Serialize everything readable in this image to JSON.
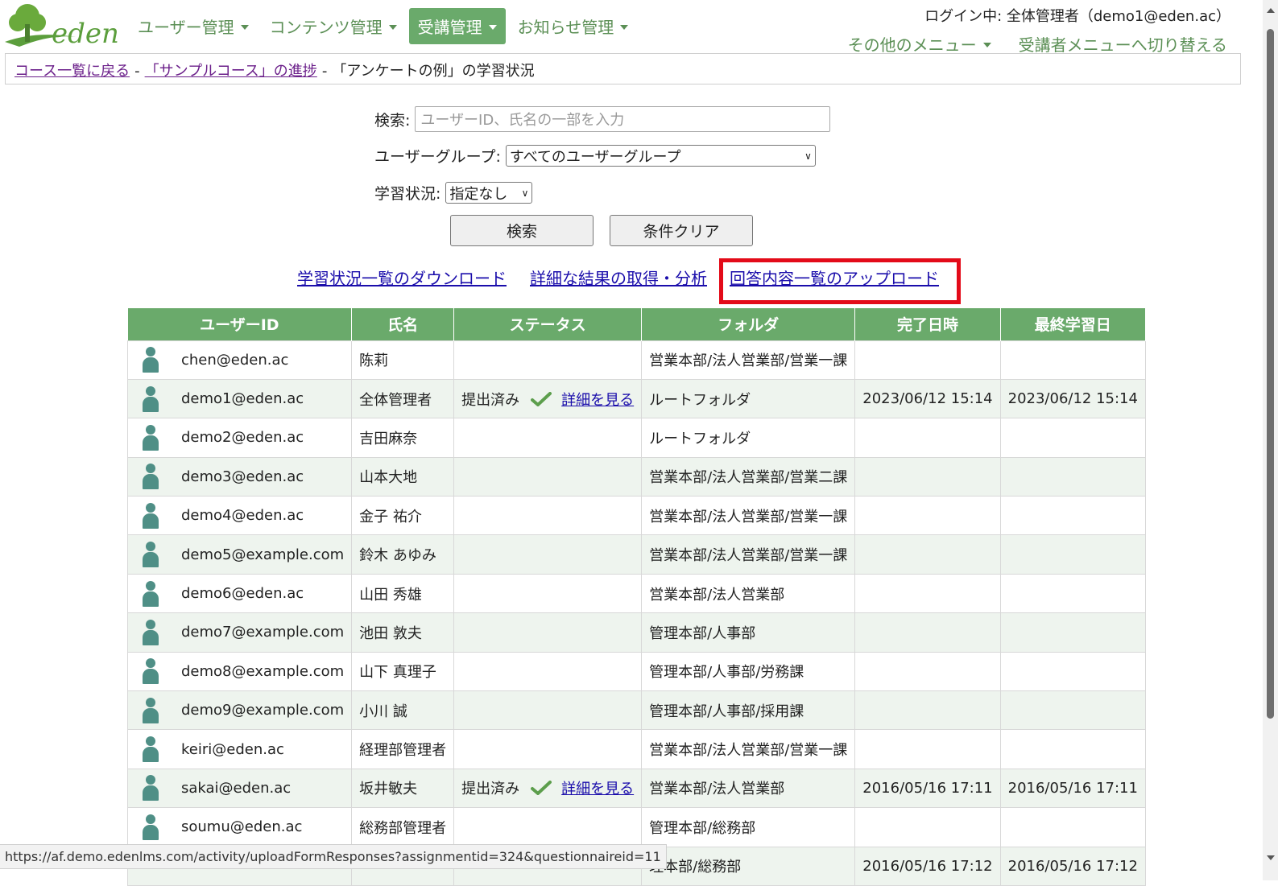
{
  "header": {
    "logo_text": "eden",
    "nav": [
      {
        "label": "ユーザー管理"
      },
      {
        "label": "コンテンツ管理"
      },
      {
        "label": "受講管理"
      },
      {
        "label": "お知らせ管理"
      }
    ],
    "login_info": "ログイン中: 全体管理者（demo1@eden.ac）",
    "other_menu": "その他のメニュー",
    "switch_menu": "受講者メニューへ切り替える"
  },
  "breadcrumb": {
    "course_list": "コース一覧に戻る",
    "course_progress": "「サンプルコース」の進捗",
    "current": "「アンケートの例」の学習状況",
    "sep": "-"
  },
  "search": {
    "keyword_label": "検索:",
    "keyword_placeholder": "ユーザーID、氏名の一部を入力",
    "group_label": "ユーザーグループ:",
    "group_value": "すべてのユーザーグループ",
    "status_label": "学習状況:",
    "status_value": "指定なし",
    "search_button": "検索",
    "clear_button": "条件クリア"
  },
  "links": {
    "download": "学習状況一覧のダウンロード",
    "analysis": "詳細な結果の取得・分析",
    "upload": "回答内容一覧のアップロード"
  },
  "table": {
    "headers": [
      "ユーザーID",
      "氏名",
      "ステータス",
      "フォルダ",
      "完了日時",
      "最終学習日"
    ],
    "rows": [
      {
        "uid": "chen@eden.ac",
        "name": "陈莉",
        "status": "",
        "detail": "",
        "folder": "営業本部/法人営業部/営業一課",
        "completed": "",
        "last": ""
      },
      {
        "uid": "demo1@eden.ac",
        "name": "全体管理者",
        "status": "提出済み",
        "detail": "詳細を見る",
        "folder": "ルートフォルダ",
        "completed": "2023/06/12 15:14",
        "last": "2023/06/12 15:14"
      },
      {
        "uid": "demo2@eden.ac",
        "name": "吉田麻奈",
        "status": "",
        "detail": "",
        "folder": "ルートフォルダ",
        "completed": "",
        "last": ""
      },
      {
        "uid": "demo3@eden.ac",
        "name": "山本大地",
        "status": "",
        "detail": "",
        "folder": "営業本部/法人営業部/営業二課",
        "completed": "",
        "last": ""
      },
      {
        "uid": "demo4@eden.ac",
        "name": "金子 祐介",
        "status": "",
        "detail": "",
        "folder": "営業本部/法人営業部/営業一課",
        "completed": "",
        "last": ""
      },
      {
        "uid": "demo5@example.com",
        "name": "鈴木 あゆみ",
        "status": "",
        "detail": "",
        "folder": "営業本部/法人営業部/営業一課",
        "completed": "",
        "last": ""
      },
      {
        "uid": "demo6@eden.ac",
        "name": "山田 秀雄",
        "status": "",
        "detail": "",
        "folder": "営業本部/法人営業部",
        "completed": "",
        "last": ""
      },
      {
        "uid": "demo7@example.com",
        "name": "池田 敦夫",
        "status": "",
        "detail": "",
        "folder": "管理本部/人事部",
        "completed": "",
        "last": ""
      },
      {
        "uid": "demo8@example.com",
        "name": "山下 真理子",
        "status": "",
        "detail": "",
        "folder": "管理本部/人事部/労務課",
        "completed": "",
        "last": ""
      },
      {
        "uid": "demo9@example.com",
        "name": "小川 誠",
        "status": "",
        "detail": "",
        "folder": "管理本部/人事部/採用課",
        "completed": "",
        "last": ""
      },
      {
        "uid": "keiri@eden.ac",
        "name": "経理部管理者",
        "status": "",
        "detail": "",
        "folder": "営業本部/法人営業部/営業一課",
        "completed": "",
        "last": ""
      },
      {
        "uid": "sakai@eden.ac",
        "name": "坂井敏夫",
        "status": "提出済み",
        "detail": "詳細を見る",
        "folder": "営業本部/法人営業部",
        "completed": "2016/05/16 17:11",
        "last": "2016/05/16 17:11"
      },
      {
        "uid": "soumu@eden.ac",
        "name": "総務部管理者",
        "status": "",
        "detail": "",
        "folder": "管理本部/総務部",
        "completed": "",
        "last": ""
      },
      {
        "uid": "",
        "name": "",
        "status": "",
        "detail": "",
        "folder": "理本部/総務部",
        "completed": "2016/05/16 17:12",
        "last": "2016/05/16 17:12"
      }
    ]
  },
  "status_bar": "https://af.demo.edenlms.com/activity/uploadFormResponses?assignmentid=324&questionnaireid=11",
  "colors": {
    "accent": "#6aaa6b",
    "highlight": "#e30b19",
    "icon": "#4f8f86"
  }
}
